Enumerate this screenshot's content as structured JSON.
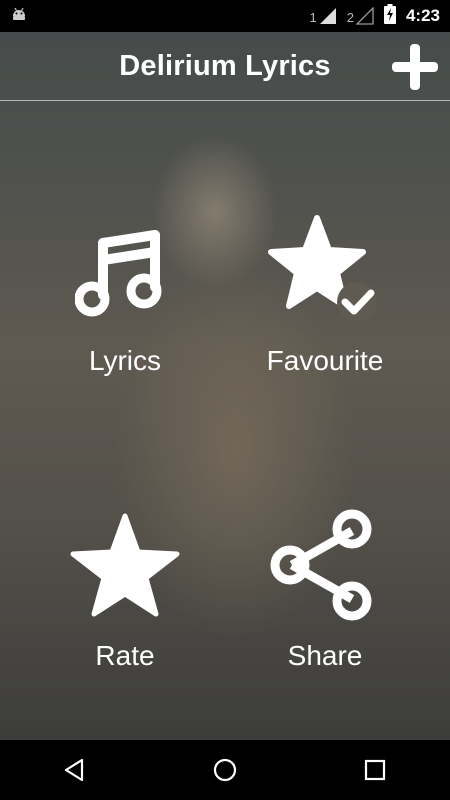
{
  "status_bar": {
    "sim1": "1",
    "sim2": "2",
    "time": "4:23",
    "icons": [
      "android-debug-icon",
      "signal-icon",
      "battery-charging-icon"
    ]
  },
  "app_bar": {
    "title": "Delirium Lyrics",
    "add_icon": "plus-icon"
  },
  "menu": {
    "lyrics": {
      "label": "Lyrics",
      "icon": "music-note-icon"
    },
    "favourite": {
      "label": "Favourite",
      "icon": "star-check-icon"
    },
    "rate": {
      "label": "Rate",
      "icon": "star-icon"
    },
    "share": {
      "label": "Share",
      "icon": "share-icon"
    }
  },
  "nav_bar": {
    "icons": [
      "back-icon",
      "home-icon",
      "recents-icon"
    ]
  }
}
